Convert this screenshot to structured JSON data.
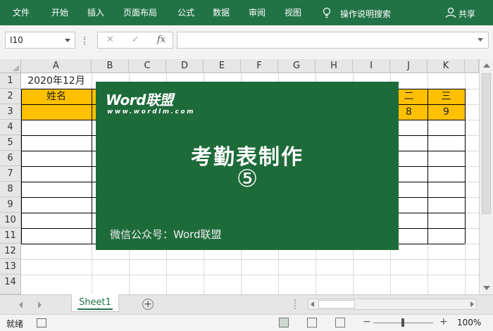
{
  "ribbon": {
    "tabs": [
      "文件",
      "开始",
      "插入",
      "页面布局",
      "公式",
      "数据",
      "审阅",
      "视图"
    ],
    "search_label": "操作说明搜索",
    "share_label": "共享"
  },
  "formula_bar": {
    "name_box": "I10",
    "cancel_symbol": "✕",
    "enter_symbol": "✓",
    "fx_symbol": "fx",
    "formula": ""
  },
  "sheet": {
    "columns": [
      "A",
      "B",
      "C",
      "D",
      "E",
      "F",
      "G",
      "H",
      "I",
      "J",
      "K"
    ],
    "rows": [
      "1",
      "2",
      "3",
      "4",
      "5",
      "6",
      "7",
      "8",
      "9",
      "10",
      "11",
      "12",
      "13",
      "14"
    ],
    "cells": {
      "a1": "2020年12月",
      "a2": "姓名",
      "j2": "二",
      "k2": "三",
      "j3": "8",
      "k3": "9"
    },
    "header_fill_color": "#ffc000"
  },
  "overlay": {
    "logo": "Word联盟",
    "site": "www.wordlm.com",
    "title": "考勤表制作",
    "number": "⑤",
    "footer": "微信公众号：Word联盟",
    "bg_color": "#1e6b3a"
  },
  "tabs_bar": {
    "sheet_name": "Sheet1",
    "add_symbol": "+"
  },
  "status_bar": {
    "ready": "就绪",
    "zoom_minus": "−",
    "zoom_plus": "+",
    "zoom": "100%"
  },
  "theme": {
    "accent": "#217346"
  }
}
